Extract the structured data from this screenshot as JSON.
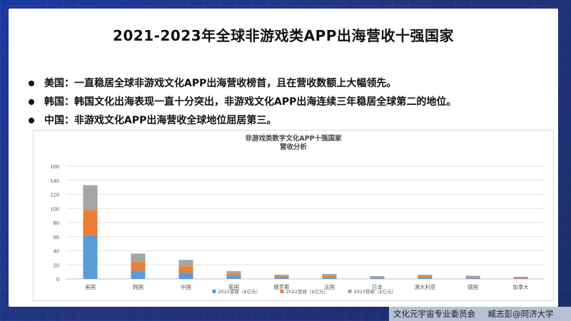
{
  "slide": {
    "title": "2021-2023年全球非游戏类APP出海营收十强国家",
    "bullets": [
      "美国：一直稳居全球非游戏文化APP出海营收榜首，且在营收数额上大幅领先。",
      "韩国：韩国文化出海表现一直十分突出，非游戏文化APP出海连续三年稳居全球第二的地位。",
      "中国：非游戏文化APP出海营收全球地位屈居第三。"
    ]
  },
  "footer": {
    "org": "文化元宇宙专业委员会",
    "author": "臧志彭@同济大学"
  },
  "chart_data": {
    "type": "bar",
    "stacked": true,
    "title": "非游戏类数字文化APP十强国家",
    "subtitle": "营收分析",
    "categories": [
      "美国",
      "韩国",
      "中国",
      "英国",
      "俄罗斯",
      "法国",
      "日本",
      "澳大利亚",
      "德国",
      "加拿大"
    ],
    "series": [
      {
        "name": "2021营收（$亿元）",
        "color": "#5b9bd5",
        "values": [
          62,
          12,
          9,
          4,
          1.5,
          1.5,
          1,
          1.5,
          1.2,
          0.5
        ]
      },
      {
        "name": "2022营收（$亿元）",
        "color": "#ed7d31",
        "values": [
          36,
          12,
          9,
          3,
          2,
          2.5,
          1,
          2.5,
          1.5,
          1
        ]
      },
      {
        "name": "2023营收（$亿元）",
        "color": "#a5a5a5",
        "values": [
          35,
          12,
          9,
          4,
          2.5,
          3,
          2,
          2,
          1.8,
          1.5
        ]
      }
    ],
    "yticks": [
      0,
      20,
      40,
      60,
      80,
      100,
      120,
      140,
      160
    ],
    "ylim": [
      0,
      160
    ],
    "grid": true,
    "legend": "bottom"
  }
}
